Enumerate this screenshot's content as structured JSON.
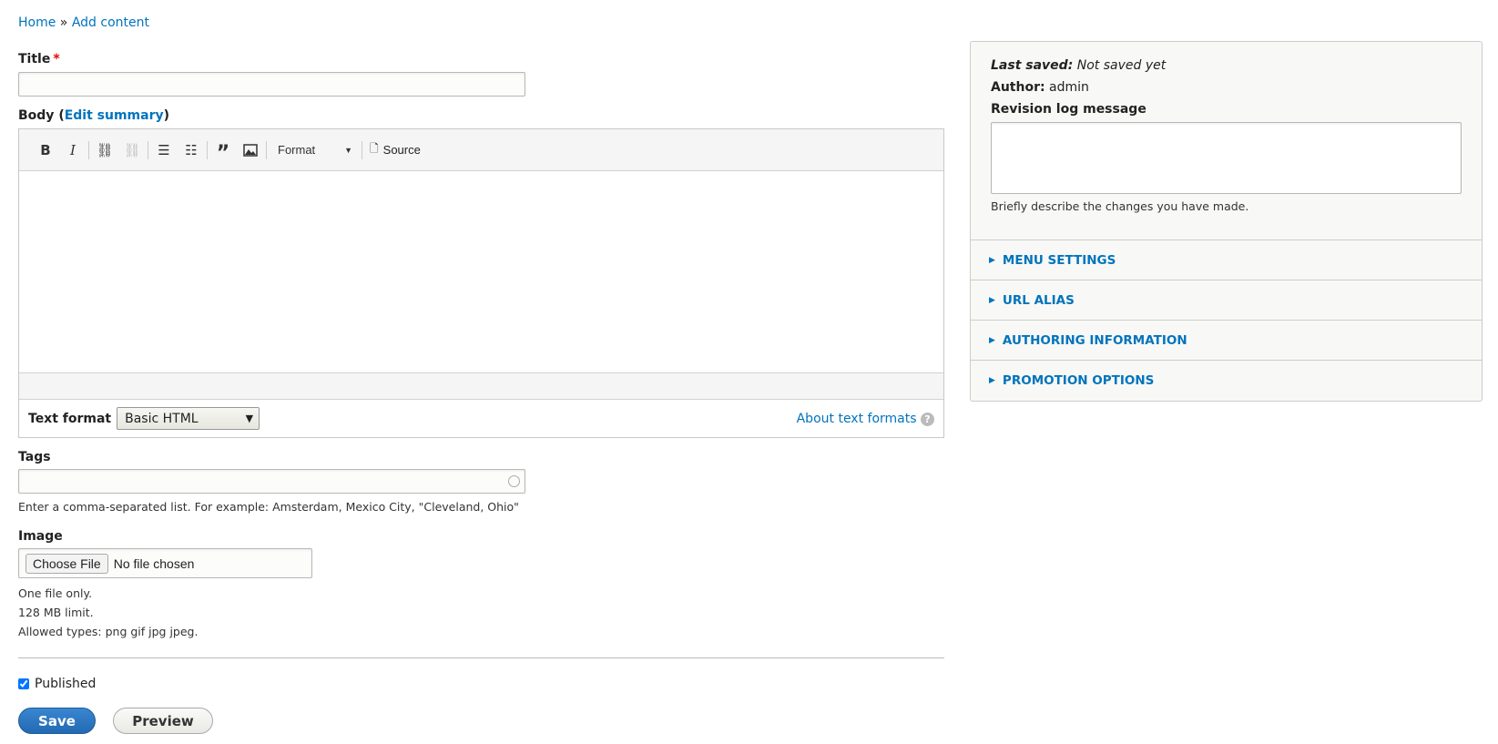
{
  "breadcrumb": {
    "home": "Home",
    "sep": "»",
    "current": "Add content"
  },
  "title": {
    "label": "Title",
    "required": "*",
    "value": ""
  },
  "body": {
    "label": "Body",
    "open": "(",
    "edit_summary": "Edit summary",
    "close": ")",
    "toolbar": {
      "format": "Format",
      "source": "Source"
    },
    "text_format_label": "Text format",
    "text_format_value": "Basic HTML",
    "about": "About text formats"
  },
  "tags": {
    "label": "Tags",
    "value": "",
    "description": "Enter a comma-separated list. For example: Amsterdam, Mexico City, \"Cleveland, Ohio\""
  },
  "image": {
    "label": "Image",
    "choose": "Choose File",
    "no_file": "No file chosen",
    "desc1": "One file only.",
    "desc2": "128 MB limit.",
    "desc3": "Allowed types: png gif jpg jpeg."
  },
  "published": {
    "label": "Published",
    "checked": true
  },
  "actions": {
    "save": "Save",
    "preview": "Preview"
  },
  "sidebar": {
    "last_saved_label": "Last saved:",
    "last_saved_value": "Not saved yet",
    "author_label": "Author:",
    "author_value": "admin",
    "revision_label": "Revision log message",
    "revision_value": "",
    "revision_desc": "Briefly describe the changes you have made.",
    "sections": [
      "MENU SETTINGS",
      "URL ALIAS",
      "AUTHORING INFORMATION",
      "PROMOTION OPTIONS"
    ]
  },
  "colors": {
    "link": "#0074bd",
    "primary_button": "#2f7ac6",
    "required": "#e00"
  }
}
